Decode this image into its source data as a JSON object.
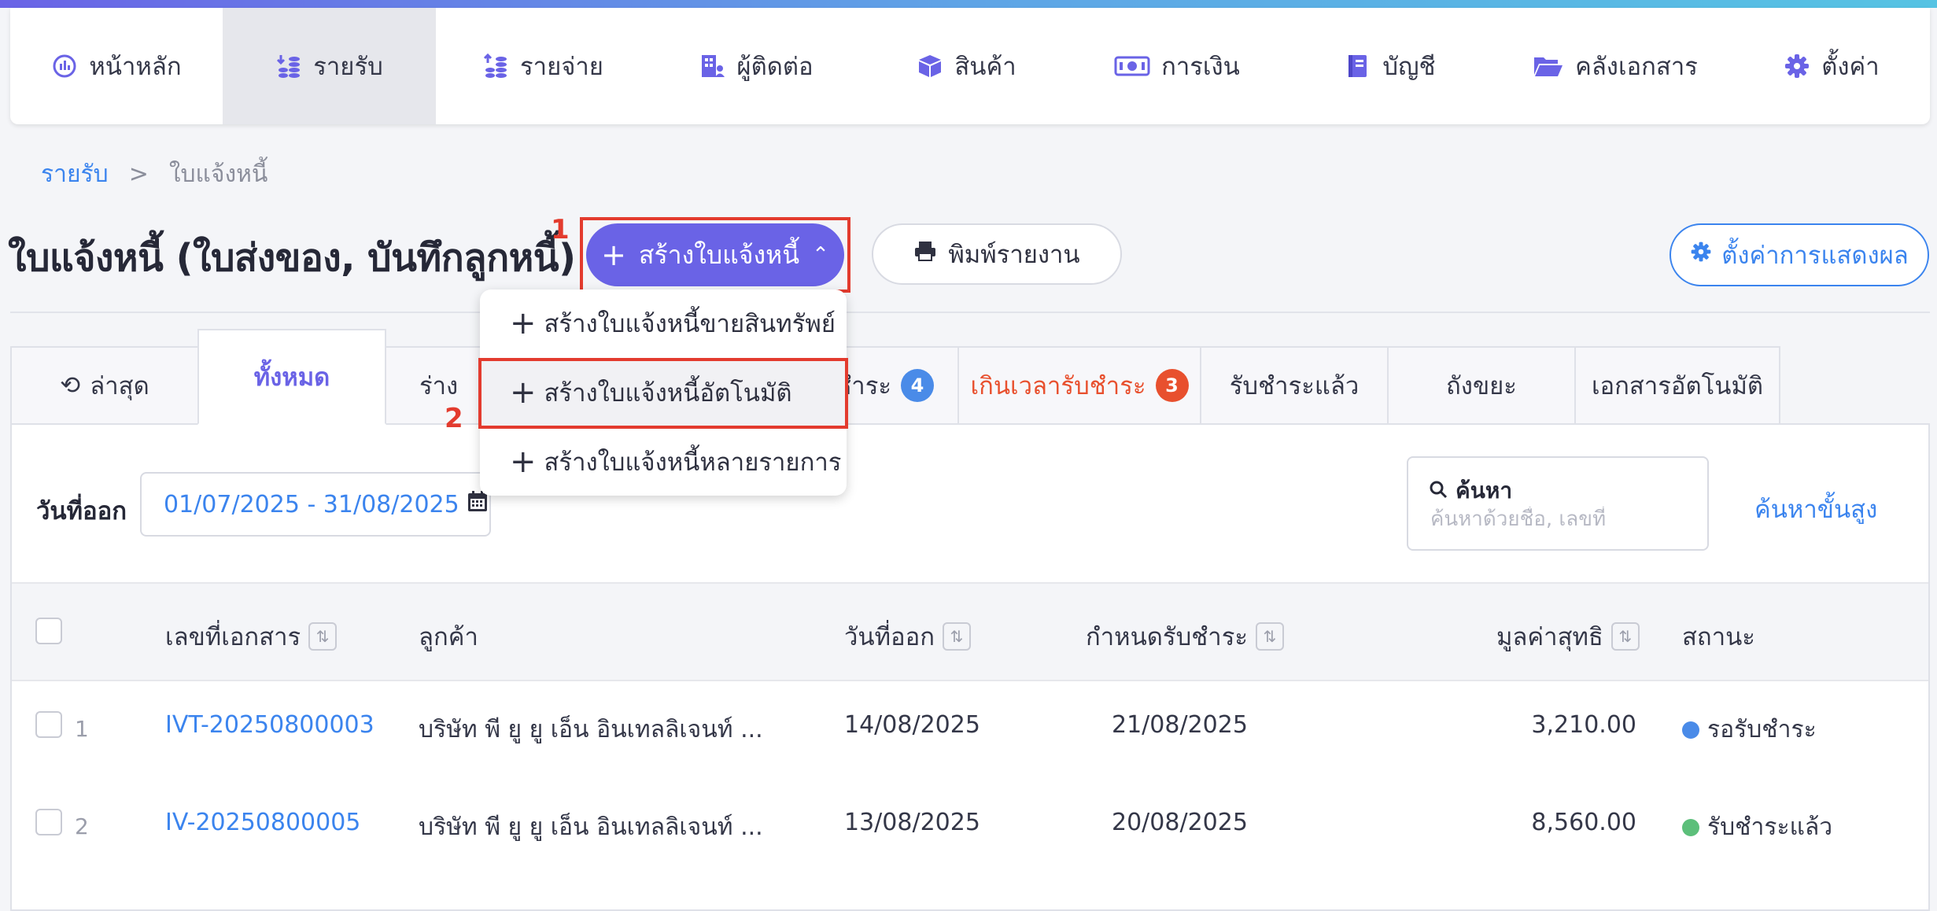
{
  "nav": {
    "items": [
      {
        "label": "หน้าหลัก",
        "icon": "dashboard-icon"
      },
      {
        "label": "รายรับ",
        "icon": "income-coins-icon"
      },
      {
        "label": "รายจ่าย",
        "icon": "expense-coins-icon"
      },
      {
        "label": "ผู้ติดต่อ",
        "icon": "contacts-building-icon"
      },
      {
        "label": "สินค้า",
        "icon": "product-box-icon"
      },
      {
        "label": "การเงิน",
        "icon": "money-icon"
      },
      {
        "label": "บัญชี",
        "icon": "ledger-book-icon"
      },
      {
        "label": "คลังเอกสาร",
        "icon": "folder-open-icon"
      },
      {
        "label": "ตั้งค่า",
        "icon": "gear-icon"
      }
    ],
    "active_index": 1
  },
  "breadcrumb": {
    "parent": "รายรับ",
    "separator": ">",
    "current": "ใบแจ้งหนี้"
  },
  "page": {
    "title": "ใบแจ้งหนี้ (ใบส่งของ, บันทึกลูกหนี้)"
  },
  "annotations": {
    "one": "1",
    "two": "2"
  },
  "actions": {
    "create_label": "สร้างใบแจ้งหนี้",
    "print_label": "พิมพ์รายงาน",
    "display_settings_label": "ตั้งค่าการแสดงผล"
  },
  "dropdown": {
    "items": [
      {
        "label": "สร้างใบแจ้งหนี้ขายสินทรัพย์"
      },
      {
        "label": "สร้างใบแจ้งหนี้อัตโนมัติ"
      },
      {
        "label": "สร้างใบแจ้งหนี้หลายรายการ"
      }
    ]
  },
  "tabs": [
    {
      "label": "ล่าสุด",
      "icon": "history-icon"
    },
    {
      "label": "ทั้งหมด"
    },
    {
      "label": "ร่าง"
    },
    {
      "label": "ชำระ",
      "badge": "4"
    },
    {
      "label": "เกินเวลารับชำระ",
      "badge": "3"
    },
    {
      "label": "รับชำระแล้ว"
    },
    {
      "label": "ถังขยะ"
    },
    {
      "label": "เอกสารอัตโนมัติ"
    }
  ],
  "filter": {
    "date_label": "วันที่ออก",
    "date_range": "01/07/2025 - 31/08/2025",
    "search_label": "ค้นหา",
    "search_placeholder": "ค้นหาด้วยชื่อ, เลขที่",
    "advanced_search": "ค้นหาขั้นสูง"
  },
  "table": {
    "columns": {
      "doc_no": "เลขที่เอกสาร",
      "customer": "ลูกค้า",
      "issue_date": "วันที่ออก",
      "due_date": "กำหนดรับชำระ",
      "net_amount": "มูลค่าสุทธิ",
      "status": "สถานะ"
    },
    "rows": [
      {
        "num": "1",
        "doc_no": "IVT-20250800003",
        "customer": "บริษัท พี ยู ยู เอ็น อินเทลลิเจนท์ ...",
        "issue_date": "14/08/2025",
        "due_date": "21/08/2025",
        "net_amount": "3,210.00",
        "status": "รอรับชำระ",
        "status_color": "#4a8be8"
      },
      {
        "num": "2",
        "doc_no": "IV-20250800005",
        "customer": "บริษัท พี ยู ยู เอ็น อินเทลลิเจนท์ ...",
        "issue_date": "13/08/2025",
        "due_date": "20/08/2025",
        "net_amount": "8,560.00",
        "status": "รับชำระแล้ว",
        "status_color": "#5cbf7a"
      }
    ]
  },
  "colors": {
    "primary": "#6a63e6",
    "link": "#3b84ee",
    "danger": "#e8502e",
    "annotation": "#e33b2e"
  }
}
